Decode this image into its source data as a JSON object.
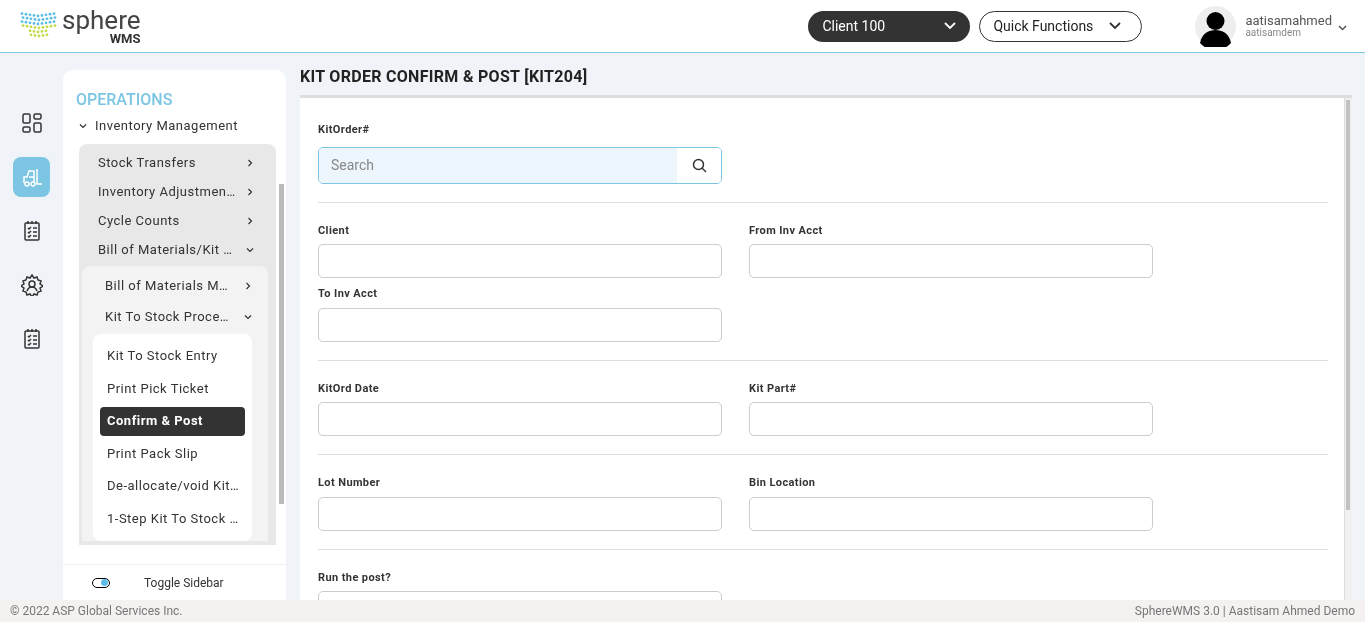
{
  "header": {
    "logo": {
      "name": "sphere",
      "sub": "WMS"
    },
    "client_select": "Client 100",
    "quick_functions": "Quick Functions",
    "user": {
      "name": "aatisamahmed",
      "login": "aatisamdem"
    }
  },
  "rail": [
    {
      "kind": "dashboard",
      "selected": false
    },
    {
      "kind": "forklift",
      "selected": true
    },
    {
      "kind": "checklist",
      "selected": false
    },
    {
      "kind": "gear",
      "selected": false
    },
    {
      "kind": "checklist",
      "selected": false
    }
  ],
  "sidebar": {
    "heading": "OPERATIONS",
    "items": [
      {
        "label": "Inventory Management",
        "expanded": true,
        "children": [
          {
            "label": "Stock Transfers",
            "expanded": false
          },
          {
            "label": "Inventory Adjustmen…",
            "expanded": false
          },
          {
            "label": "Cycle Counts",
            "expanded": false
          },
          {
            "label": "Bill of Materials/Kit …",
            "expanded": true,
            "children": [
              {
                "label": "Bill of Materials M…",
                "expanded": false
              },
              {
                "label": "Kit To Stock Proce…",
                "expanded": true,
                "children": [
                  {
                    "label": "Kit To Stock Entry",
                    "selected": false
                  },
                  {
                    "label": "Print Pick Ticket",
                    "selected": false
                  },
                  {
                    "label": "Confirm & Post",
                    "selected": true
                  },
                  {
                    "label": "Print Pack Slip",
                    "selected": false
                  },
                  {
                    "label": "De-allocate/void Kit…",
                    "selected": false
                  },
                  {
                    "label": "1-Step Kit To Stock …",
                    "selected": false
                  }
                ]
              }
            ]
          }
        ]
      }
    ],
    "toggle": {
      "label": "Toggle Sidebar",
      "on": true
    }
  },
  "page_title": "KIT ORDER CONFIRM & POST [KIT204]",
  "sections": [
    {
      "fields": [
        {
          "label": "KitOrder#",
          "kind": "search",
          "placeholder": "Search"
        }
      ]
    },
    {
      "fields": [
        {
          "label": "Client",
          "kind": "text"
        },
        {
          "label": "From Inv Acct",
          "kind": "text"
        },
        {
          "label": "To Inv Acct",
          "kind": "text"
        }
      ]
    },
    {
      "fields": [
        {
          "label": "KitOrd Date",
          "kind": "text"
        },
        {
          "label": "Kit Part#",
          "kind": "text"
        }
      ]
    },
    {
      "fields": [
        {
          "label": "Lot Number",
          "kind": "text"
        },
        {
          "label": "Bin Location",
          "kind": "text"
        }
      ]
    },
    {
      "fields": [
        {
          "label": "Run the post?",
          "kind": "text"
        }
      ]
    }
  ],
  "footer": {
    "copyright": "© 2022 ASP Global Services Inc.",
    "version": "SphereWMS 3.0 | Aastisam Ahmed Demo"
  }
}
